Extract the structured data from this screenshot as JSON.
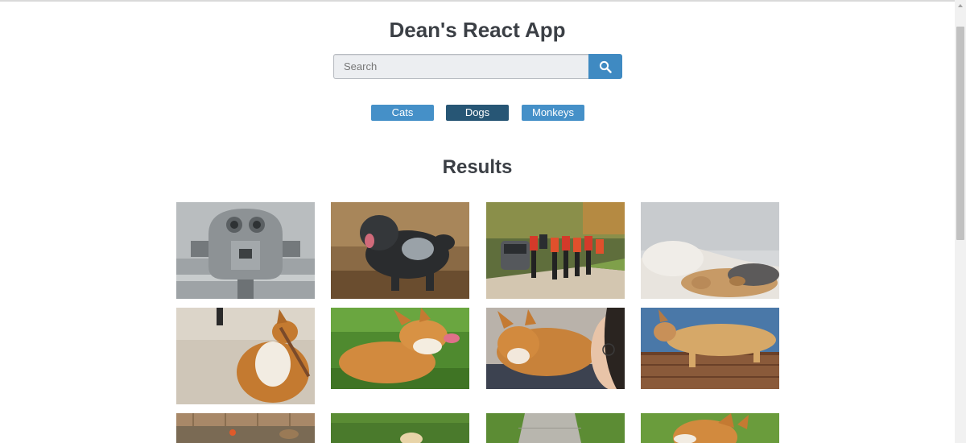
{
  "header": {
    "title": "Dean's React App"
  },
  "search": {
    "placeholder": "Search",
    "value": "",
    "button_icon": "search-icon"
  },
  "categories": [
    {
      "label": "Cats",
      "active": false
    },
    {
      "label": "Dogs",
      "active": true
    },
    {
      "label": "Monkeys",
      "active": false
    }
  ],
  "results": {
    "title": "Results"
  },
  "colors": {
    "primary": "#4590c8",
    "active": "#275675",
    "search_button": "#3f8ac2",
    "heading": "#3b3f45"
  }
}
